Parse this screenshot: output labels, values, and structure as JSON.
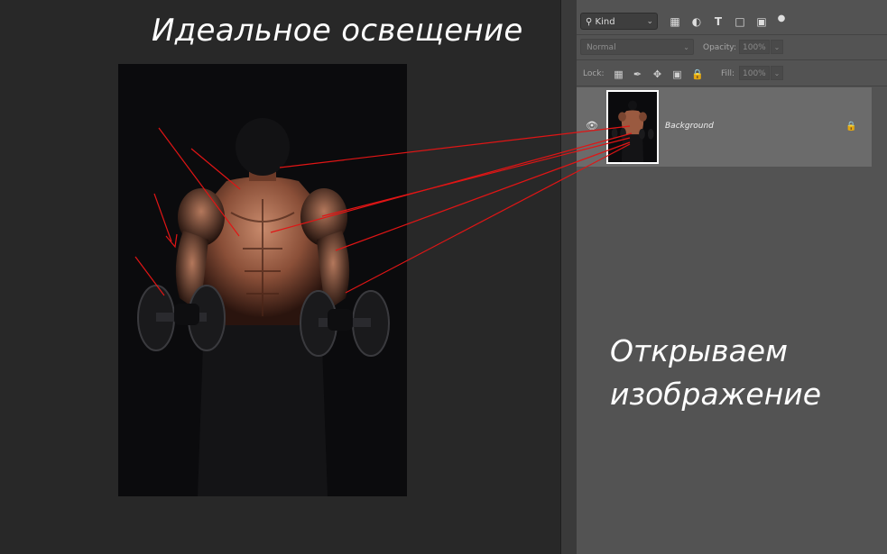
{
  "canvas": {
    "title": "Идеальное освещение"
  },
  "panel": {
    "filter": {
      "kind_label": "Kind",
      "icons": [
        "image-filter-icon",
        "adjustment-filter-icon",
        "type-filter-icon",
        "shape-filter-icon",
        "smart-object-filter-icon",
        "filter-toggle-icon"
      ]
    },
    "blend_mode": "Normal",
    "opacity_label": "Opacity:",
    "opacity_value": "100%",
    "lock_label": "Lock:",
    "fill_label": "Fill:",
    "fill_value": "100%",
    "lock_icons": [
      "lock-transparent-icon",
      "lock-image-icon",
      "lock-position-icon",
      "lock-artboard-icon",
      "lock-all-icon"
    ],
    "layers": [
      {
        "name": "Background",
        "visible": true,
        "locked": true,
        "selected": true
      }
    ]
  },
  "caption": {
    "line1": "Открываем",
    "line2": "изображение"
  },
  "colors": {
    "annotation": "#e01515",
    "panel": "#535353",
    "selected_layer": "#6b6b6b",
    "workspace": "#282828"
  }
}
